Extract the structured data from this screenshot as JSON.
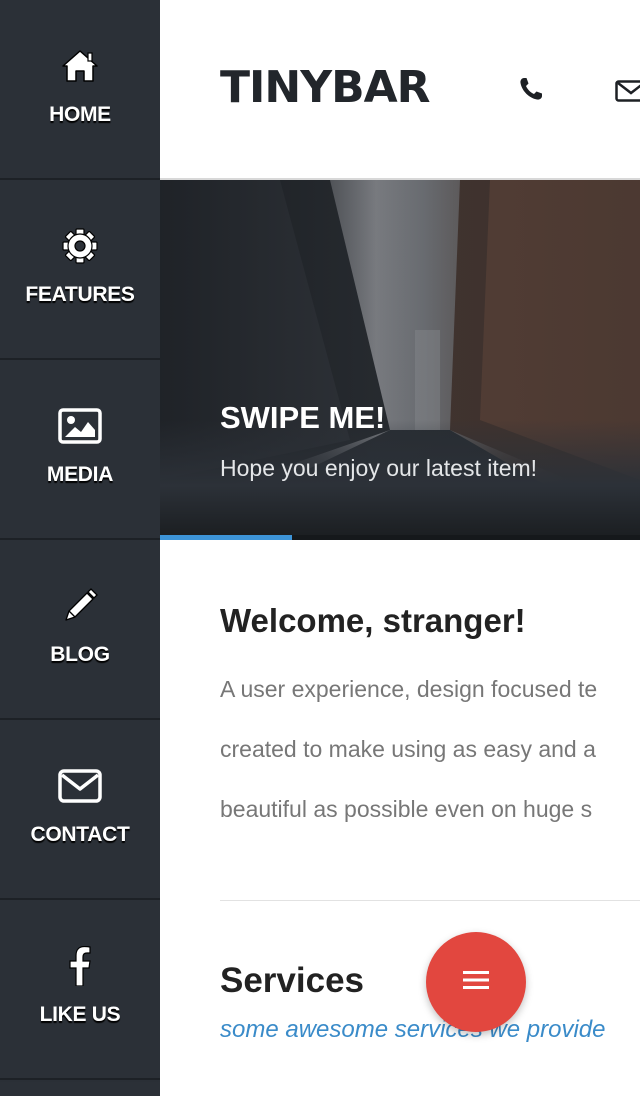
{
  "sidebar": {
    "items": [
      {
        "label": "HOME",
        "icon": "home-icon"
      },
      {
        "label": "FEATURES",
        "icon": "gear-icon"
      },
      {
        "label": "MEDIA",
        "icon": "image-icon"
      },
      {
        "label": "BLOG",
        "icon": "pencil-icon"
      },
      {
        "label": "CONTACT",
        "icon": "envelope-icon"
      },
      {
        "label": "LIKE US",
        "icon": "facebook-icon"
      }
    ]
  },
  "header": {
    "logo": "TINYBAR",
    "icons": [
      "phone-icon",
      "envelope-icon"
    ]
  },
  "slider": {
    "title": "SWIPE ME!",
    "subtitle": "Hope you enjoy our latest item!",
    "progress": 0.275
  },
  "welcome": {
    "title": "Welcome, stranger!",
    "lines": [
      "A user experience, design focused te",
      "created to make using as easy and a",
      "beautiful as possible even on huge s"
    ]
  },
  "services": {
    "title": "Services",
    "subtitle": "some awesome services we provide"
  },
  "fab": {
    "icon": "menu-icon"
  },
  "colors": {
    "sidebar": "#2b3037",
    "accent_blue": "#3d94d8",
    "fab_red": "#e2473f",
    "link_blue": "#3a8bc9"
  }
}
